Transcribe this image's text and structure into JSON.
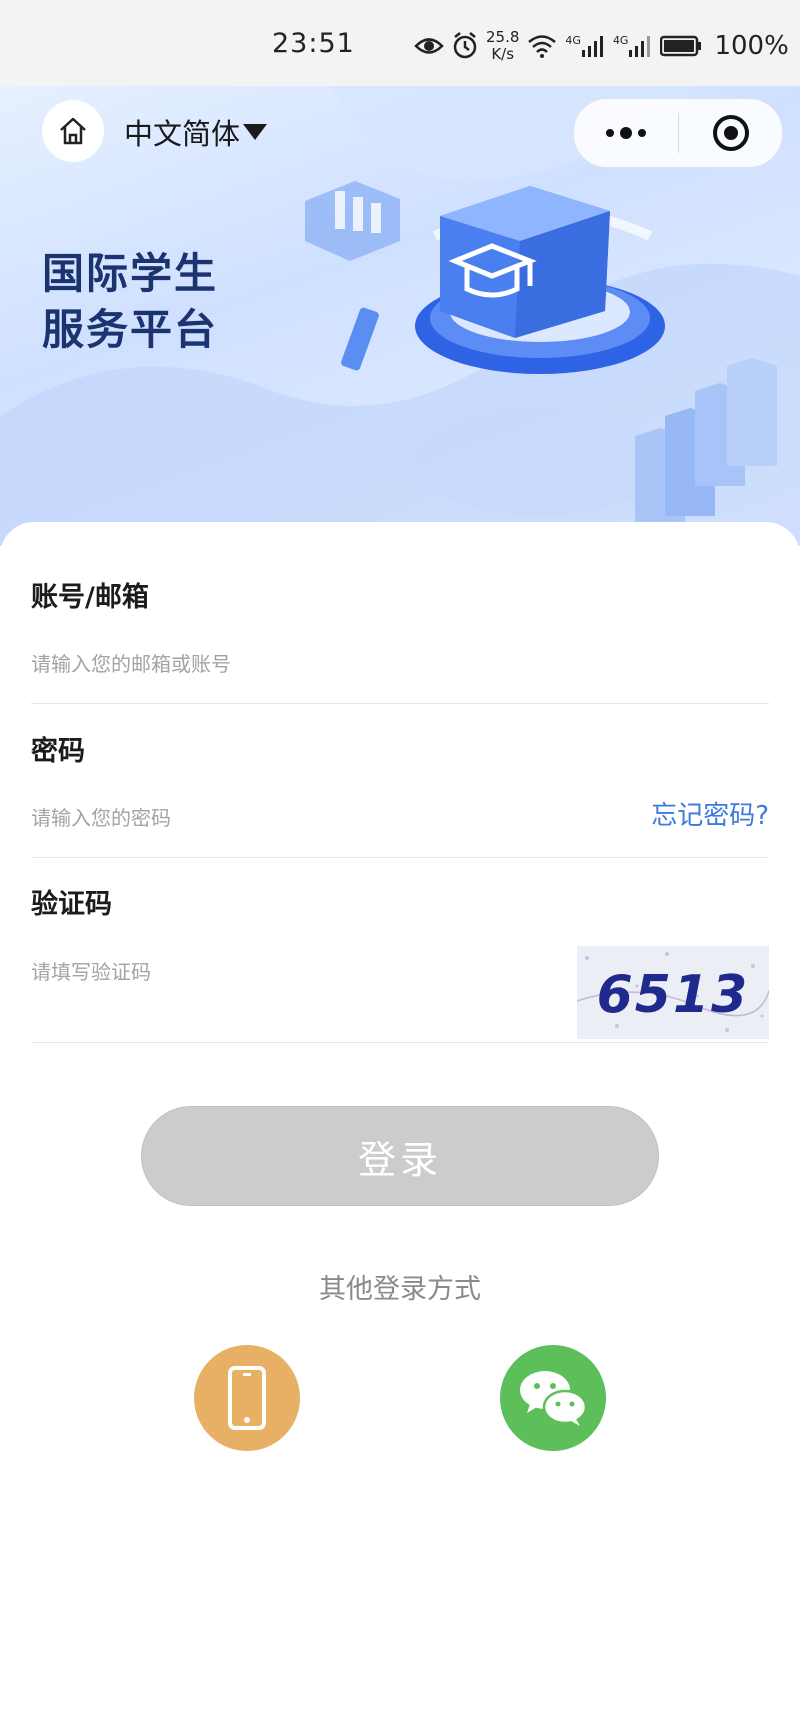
{
  "status_bar": {
    "time": "23:51",
    "net_speed_value": "25.8",
    "net_speed_unit": "K/s",
    "signal_1_label": "4G",
    "signal_2_label": "4G",
    "battery": "100%"
  },
  "header": {
    "language": "中文简体",
    "home_icon": "home-icon",
    "more_icon": "more-dots-icon",
    "close_icon": "target-close-icon"
  },
  "hero": {
    "title_line1": "国际学生",
    "title_line2": "服务平台"
  },
  "form": {
    "account": {
      "label": "账号/邮箱",
      "placeholder": "请输入您的邮箱或账号"
    },
    "password": {
      "label": "密码",
      "placeholder": "请输入您的密码",
      "forgot": "忘记密码?"
    },
    "captcha": {
      "label": "验证码",
      "placeholder": "请填写验证码",
      "image_text": "6513"
    }
  },
  "login_button": "登录",
  "other_login": {
    "title": "其他登录方式",
    "methods": [
      "phone-icon",
      "wechat-icon"
    ]
  },
  "colors": {
    "accent_blue": "#3d7ae0",
    "title_navy": "#1b3470",
    "button_disabled": "#cccccc",
    "phone_orange": "#e8b065",
    "wechat_green": "#5cbf5a"
  }
}
